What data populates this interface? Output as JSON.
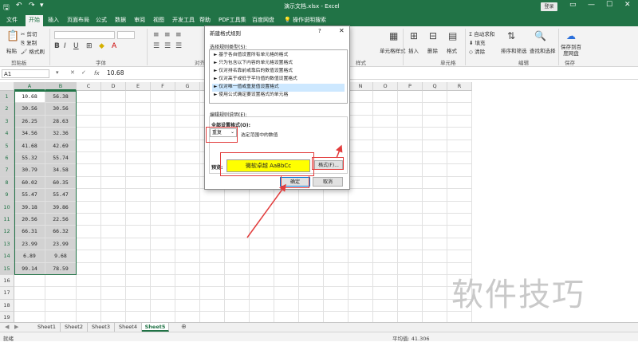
{
  "titlebar": {
    "title": "演示文档.xlsx - Excel",
    "login": "登录",
    "bg_color": "#217346"
  },
  "tabs": [
    "文件",
    "开始",
    "插入",
    "页面布局",
    "公式",
    "数据",
    "审阅",
    "视图",
    "开发工具",
    "帮助",
    "PDF工具集",
    "百度网盘"
  ],
  "tellme": "操作说明搜索",
  "ribbon": {
    "paste": "粘贴",
    "cut": "剪切",
    "copy": "复制",
    "format_painter": "格式刷",
    "clipboard_label": "剪贴板",
    "font_label": "字体",
    "align_label": "对齐",
    "style_label": "样式",
    "cell_style": "单元格样式",
    "insert": "插入",
    "delete": "删除",
    "format": "格式",
    "cells_label": "单元格",
    "autosum": "自动求和",
    "fill": "填充",
    "clear": "清除",
    "sort_filter": "排序和筛选",
    "find_select": "查找和选择",
    "edit_label": "编辑",
    "save_baidu": "保存到百度网盘",
    "save_label": "保存"
  },
  "formula_bar": {
    "name_box": "A1",
    "fx": "fx",
    "value": "10.68"
  },
  "grid": {
    "columns": [
      "A",
      "B",
      "C",
      "D",
      "E",
      "F",
      "G",
      "H",
      "I",
      "J",
      "K",
      "L",
      "M",
      "N",
      "O",
      "P",
      "Q",
      "R"
    ],
    "rows": [
      "1",
      "2",
      "3",
      "4",
      "5",
      "6",
      "7",
      "8",
      "9",
      "10",
      "11",
      "12",
      "13",
      "14",
      "15",
      "16",
      "17",
      "18",
      "19"
    ],
    "data": [
      [
        "10.68",
        "56.38"
      ],
      [
        "30.56",
        "30.56"
      ],
      [
        "26.25",
        "28.63"
      ],
      [
        "34.56",
        "32.36"
      ],
      [
        "41.68",
        "42.69"
      ],
      [
        "55.32",
        "55.74"
      ],
      [
        "30.79",
        "34.58"
      ],
      [
        "60.02",
        "60.35"
      ],
      [
        "55.47",
        "55.47"
      ],
      [
        "39.18",
        "39.86"
      ],
      [
        "20.56",
        "22.56"
      ],
      [
        "66.31",
        "66.32"
      ],
      [
        "23.99",
        "23.99"
      ],
      [
        "6.89",
        "9.68"
      ],
      [
        "99.14",
        "78.59"
      ]
    ]
  },
  "sheets": [
    "Sheet1",
    "Sheet2",
    "Sheet3",
    "Sheet4",
    "Sheet5"
  ],
  "active_sheet": "Sheet5",
  "status": {
    "ready": "就绪",
    "average": "平均值: 41.306"
  },
  "dialog": {
    "title": "新建格式规则",
    "help": "?",
    "select_type_label": "选择规则类型(S):",
    "rule_types": [
      "► 基于各自值设置所有单元格的格式",
      "► 只为包含以下内容的单元格设置格式",
      "► 仅对排名靠前或靠后的数值设置格式",
      "► 仅对高于或低于平均值的数值设置格式",
      "► 仅对唯一值或重复值设置格式",
      "► 使用公式确定要设置格式的单元格"
    ],
    "selected_rule_index": 4,
    "edit_desc_label": "编辑规则说明(E):",
    "all_format_label": "全部设置格式(O):",
    "combo_value": "重复",
    "hint": "选定范围中的数值",
    "preview_label": "预览:",
    "preview_text": "微软卓越 AaBbCc",
    "preview_color": "#ffff00",
    "format_button": "格式(F)...",
    "ok_button": "确定",
    "cancel_button": "取消"
  },
  "watermark": "软件技巧",
  "annotation_color": "#e23c3c"
}
